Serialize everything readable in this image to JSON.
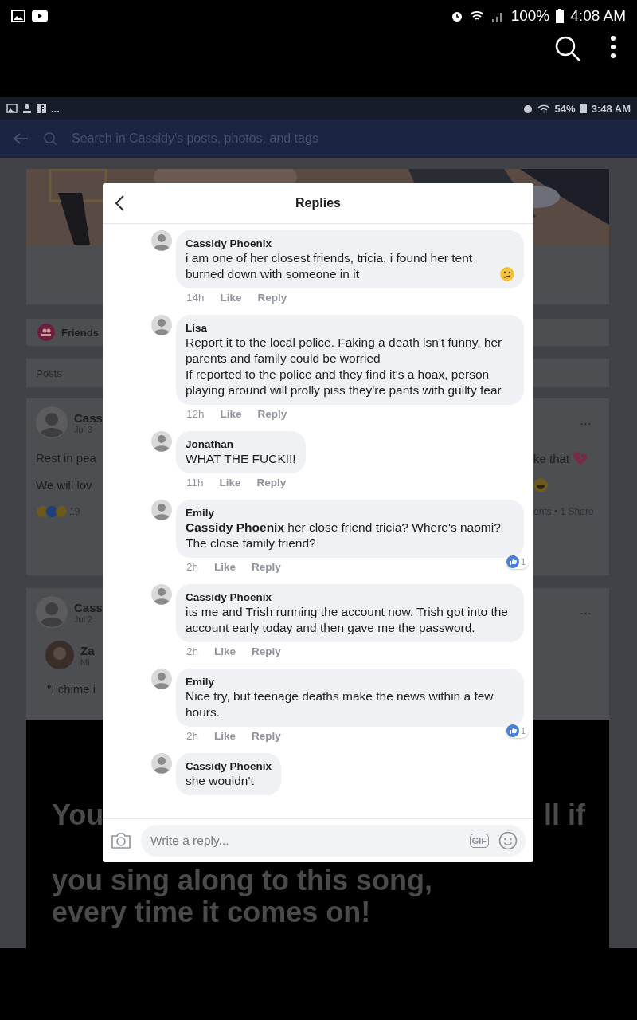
{
  "status_bar": {
    "battery": "100%",
    "time": "4:08 AM"
  },
  "screenshot": {
    "status_bar": {
      "more": "...",
      "battery": "54%",
      "time": "3:48 AM"
    },
    "search": {
      "placeholder": "Search in Cassidy's posts, photos, and tags"
    },
    "friends_label": "Friends",
    "posts_label": "Posts",
    "posts": [
      {
        "author": "Cass",
        "date": "Jul 3",
        "more": "···",
        "left_lines": [
          "Rest in pea",
          "We will lov"
        ],
        "reaction_count": "19",
        "right_line": "ke that",
        "stats": "ents • 1 Share"
      },
      {
        "author": "Cass",
        "date": "Jul 2",
        "more": "···",
        "shared_author": "Za",
        "shared_date": "Mi",
        "quote": "\"I chime i"
      }
    ],
    "video_text": {
      "left": "You",
      "right": "ll if",
      "line_2": "you sing along to this song,",
      "line_3": "every time it comes on!"
    }
  },
  "dialog": {
    "title": "Replies",
    "comments": [
      {
        "name": "Cassidy Phoenix",
        "text": "i am one of her closest friends, tricia. i found her tent burned down with someone in it",
        "emoji": true,
        "time": "14h",
        "like": "Like",
        "reply": "Reply"
      },
      {
        "name": "Lisa",
        "text": "Report it to the local police. Faking a death isn't funny, her parents and family could be worried\nIf reported to the police and they find it's a hoax, person playing around will prolly piss they're pants with guilty fear",
        "emoji": false,
        "time": "12h",
        "like": "Like",
        "reply": "Reply"
      },
      {
        "name": "Jonathan",
        "text": "WHAT THE FUCK!!!",
        "emoji": false,
        "time": "11h",
        "like": "Like",
        "reply": "Reply"
      },
      {
        "name": "Emily",
        "text": "**Cassidy Phoenix** her close friend tricia? Where's naomi? The close family friend?",
        "emoji": false,
        "time": "2h",
        "like": "Like",
        "reply": "Reply",
        "reactions": "1"
      },
      {
        "name": "Cassidy Phoenix",
        "text": "its me and Trish running the account now. Trish got into the account early today and then gave me the password.",
        "emoji": false,
        "time": "2h",
        "like": "Like",
        "reply": "Reply"
      },
      {
        "name": "Emily",
        "text": "Nice try, but teenage deaths make the news within a few hours.",
        "emoji": false,
        "time": "2h",
        "like": "Like",
        "reply": "Reply",
        "reactions": "1"
      },
      {
        "name": "Cassidy Phoenix",
        "text": "she wouldn't",
        "emoji": false
      }
    ],
    "placeholder": "Write a reply...",
    "gif_label": "GIF"
  }
}
